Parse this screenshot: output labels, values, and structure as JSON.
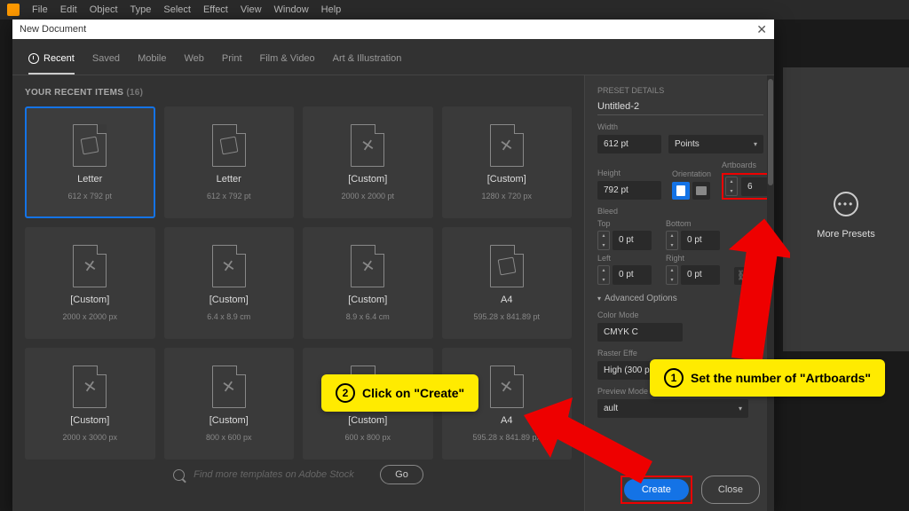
{
  "menubar": [
    "File",
    "Edit",
    "Object",
    "Type",
    "Select",
    "Effect",
    "View",
    "Window",
    "Help"
  ],
  "dialog_title": "New Document",
  "tabs": [
    "Recent",
    "Saved",
    "Mobile",
    "Web",
    "Print",
    "Film & Video",
    "Art & Illustration"
  ],
  "recent": {
    "heading": "YOUR RECENT ITEMS",
    "count": "(16)",
    "items": [
      {
        "name": "Letter",
        "dim": "612 x 792 pt",
        "icon": "ai"
      },
      {
        "name": "Letter",
        "dim": "612 x 792 pt",
        "icon": "ai"
      },
      {
        "name": "[Custom]",
        "dim": "2000 x 2000 pt",
        "icon": "pencil"
      },
      {
        "name": "[Custom]",
        "dim": "1280 x 720 px",
        "icon": "pencil"
      },
      {
        "name": "[Custom]",
        "dim": "2000 x 2000 px",
        "icon": "pencil"
      },
      {
        "name": "[Custom]",
        "dim": "6.4 x 8.9 cm",
        "icon": "pencil"
      },
      {
        "name": "[Custom]",
        "dim": "8.9 x 6.4 cm",
        "icon": "pencil"
      },
      {
        "name": "A4",
        "dim": "595.28 x 841.89 pt",
        "icon": "ai"
      },
      {
        "name": "[Custom]",
        "dim": "2000 x 3000 px",
        "icon": "pencil"
      },
      {
        "name": "[Custom]",
        "dim": "800 x 600 px",
        "icon": "pencil"
      },
      {
        "name": "[Custom]",
        "dim": "600 x 800 px",
        "icon": "pencil"
      },
      {
        "name": "A4",
        "dim": "595.28 x 841.89 px",
        "icon": "pencil"
      }
    ]
  },
  "search_placeholder": "Find more templates on Adobe Stock",
  "go_label": "Go",
  "details": {
    "heading": "PRESET DETAILS",
    "name": "Untitled-2",
    "width_label": "Width",
    "width": "612 pt",
    "units": "Points",
    "height_label": "Height",
    "height": "792 pt",
    "orientation_label": "Orientation",
    "artboards_label": "Artboards",
    "artboards": "6",
    "bleed_label": "Bleed",
    "top": "Top",
    "bottom": "Bottom",
    "left": "Left",
    "right": "Right",
    "bleed_val": "0 pt",
    "advanced_label": "Advanced Options",
    "color_mode_label": "Color Mode",
    "color_mode": "CMYK C",
    "raster_label": "Raster Effe",
    "raster": "High (300 ppi)",
    "preview_label": "Preview Mode",
    "preview": "ault"
  },
  "buttons": {
    "create": "Create",
    "close": "Close"
  },
  "more_presets": "More Presets",
  "annotations": {
    "a1": "Set the number of \"Artboards\"",
    "a2": "Click on \"Create\""
  }
}
